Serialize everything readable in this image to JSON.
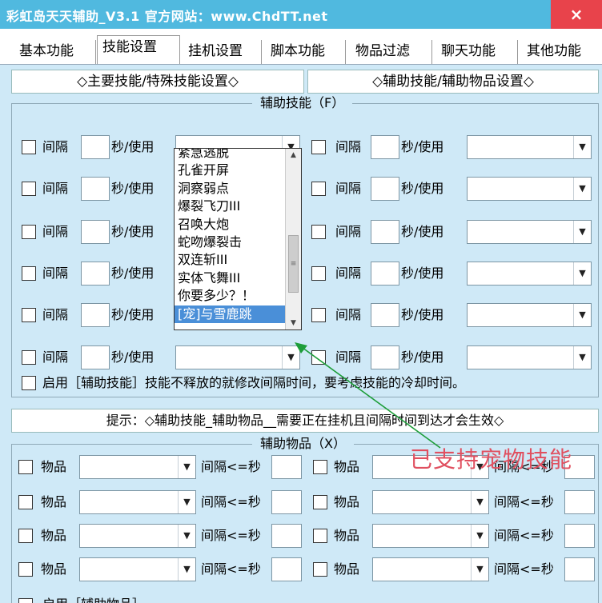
{
  "window": {
    "title": "彩虹岛天天辅助_V3.1  官方网站：www.ChdTT.net",
    "close": "×"
  },
  "tabs": [
    "基本功能",
    "技能设置",
    "挂机设置",
    "脚本功能",
    "物品过滤",
    "聊天功能",
    "其他功能"
  ],
  "subheaders": {
    "left": "◇主要技能/特殊技能设置◇",
    "right": "◇辅助技能/辅助物品设置◇"
  },
  "skill_group": {
    "legend": "辅助技能（F）",
    "interval_label": "间隔",
    "sec_use_label": "秒/使用",
    "dropdown_items": [
      "紧急逃脱",
      "孔雀开屏",
      "洞察弱点",
      "爆裂飞刀III",
      "召唤大炮",
      "蛇吻爆裂击",
      "双连斩III",
      "实体飞舞III",
      "你要多少？！",
      "[宠]与雪鹿跳"
    ],
    "enable_label": "启用［辅助技能］技能不释放的就修改间隔时间，要考虑技能的冷却时间。"
  },
  "tip": "提示：◇辅助技能_辅助物品__需要正在挂机且间隔时间到达才会生效◇",
  "item_group": {
    "legend": "辅助物品（X）",
    "item_label": "物品",
    "interval_label": "间隔<=秒",
    "enable_label": "启用［辅助物品］"
  },
  "annotation": "已支持宠物技能",
  "icons": {
    "dropdown_arrow": "▼",
    "scroll_up": "▲",
    "scroll_down": "▼",
    "scroll_grip": "≡"
  },
  "colors": {
    "titlebar": "#50b9df",
    "close": "#e8434b",
    "panel": "#cfe9f7",
    "annotation": "#e05060",
    "arrow": "#1e9e3a",
    "selection": "#4a8fd8"
  }
}
